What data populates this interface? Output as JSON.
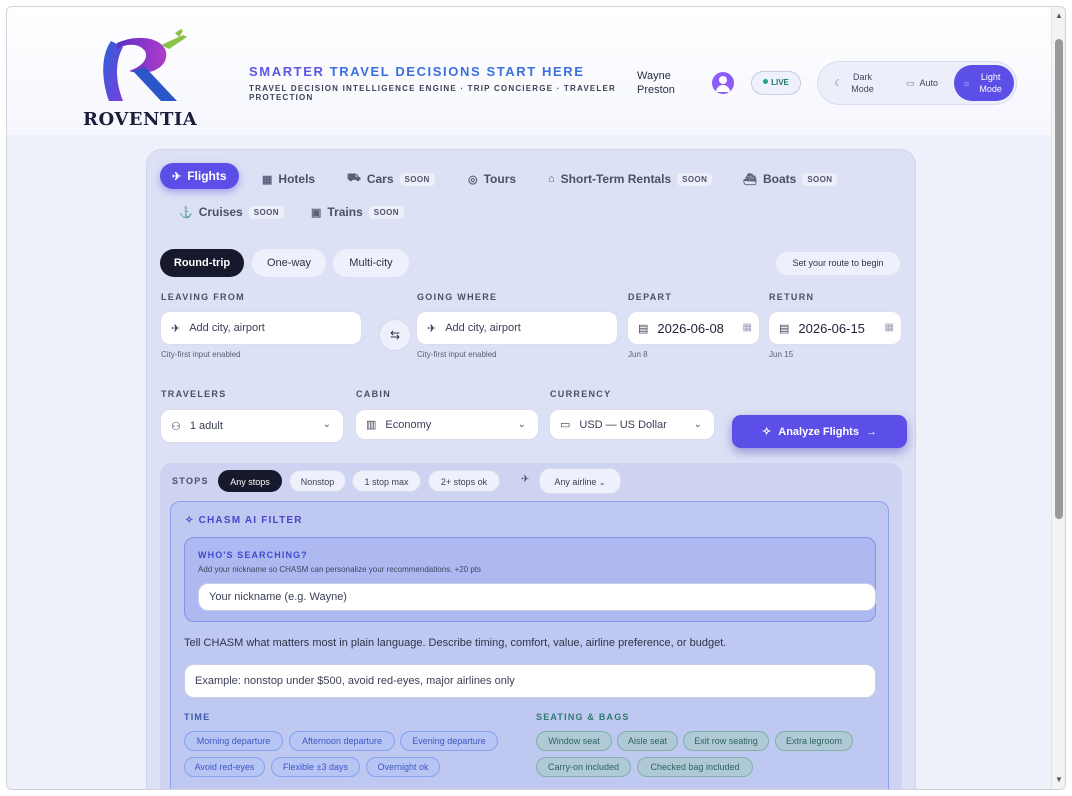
{
  "brand": {
    "name": "ROVENTIA",
    "tagline_a": "SMARTER ",
    "tagline_b": "TRAVEL DECISIONS START HERE",
    "subtagline": "TRAVEL DECISION INTELLIGENCE ENGINE · TRIP CONCIERGE · TRAVELER PROTECTION"
  },
  "header": {
    "user_name": "Wayne Preston",
    "live_label": "LIVE",
    "modes": [
      {
        "label": "Dark Mode",
        "icon": "moon-icon"
      },
      {
        "label": "Auto",
        "icon": "monitor-icon"
      },
      {
        "label": "Light Mode",
        "icon": "sun-icon",
        "active": true
      }
    ]
  },
  "tabs": [
    {
      "label": "Flights",
      "icon": "plane-logo-icon",
      "active": true
    },
    {
      "label": "Hotels",
      "icon": "building-icon"
    },
    {
      "label": "Cars",
      "icon": "car-icon",
      "badge": "SOON"
    },
    {
      "label": "Tours",
      "icon": "compass-icon"
    },
    {
      "label": "Short-Term Rentals",
      "icon": "house-icon",
      "badge": "SOON"
    },
    {
      "label": "Boats",
      "icon": "boat-icon",
      "badge": "SOON"
    },
    {
      "label": "Cruises",
      "icon": "anchor-icon",
      "badge": "SOON"
    },
    {
      "label": "Trains",
      "icon": "train-icon",
      "badge": "SOON"
    }
  ],
  "trip_types": [
    {
      "label": "Round-trip",
      "active": true
    },
    {
      "label": "One-way"
    },
    {
      "label": "Multi-city"
    }
  ],
  "route_hint": "Set your route to begin",
  "search": {
    "from_label": "LEAVING FROM",
    "from_placeholder": "Add city, airport",
    "from_hint": "City-first input enabled",
    "to_label": "GOING WHERE",
    "to_placeholder": "Add city, airport",
    "to_hint": "City-first input enabled",
    "depart_label": "DEPART",
    "depart_value": "2026-06-08",
    "depart_hint": "Jun 8",
    "return_label": "RETURN",
    "return_value": "2026-06-15",
    "return_hint": "Jun 15",
    "travelers_label": "TRAVELERS",
    "travelers_value": "1 adult",
    "cabin_label": "CABIN",
    "cabin_value": "Economy",
    "currency_label": "CURRENCY",
    "currency_value": "USD — US Dollar",
    "analyze_label": "Analyze Flights"
  },
  "stops": {
    "label": "STOPS",
    "options": [
      {
        "label": "Any stops",
        "active": true
      },
      {
        "label": "Nonstop"
      },
      {
        "label": "1 stop max"
      },
      {
        "label": "2+ stops ok"
      }
    ],
    "airline_value": "Any airline"
  },
  "ai": {
    "title": "CHASM AI FILTER",
    "who_title": "WHO'S SEARCHING?",
    "who_sub": "Add your nickname so CHASM can personalize your recommendations. +20 pts",
    "nickname_placeholder": "Your nickname (e.g. Wayne)",
    "description": "Tell CHASM what matters most in plain language. Describe timing, comfort, value, airline preference, or budget.",
    "prompt_placeholder": "Example: nonstop under $500, avoid red-eyes, major airlines only",
    "time_label": "TIME",
    "time_pills": [
      "Morning departure",
      "Afternoon departure",
      "Evening departure",
      "Avoid red-eyes",
      "Flexible ±3 days",
      "Overnight ok"
    ],
    "seating_label": "SEATING & BAGS",
    "seating_pills": [
      "Window seat",
      "Aisle seat",
      "Exit row seating",
      "Extra legroom",
      "Carry-on included",
      "Checked bag included"
    ]
  },
  "colors": {
    "accent": "#5b4fe8",
    "panel": "#dde1f5",
    "dark_chip": "#161a2c"
  }
}
